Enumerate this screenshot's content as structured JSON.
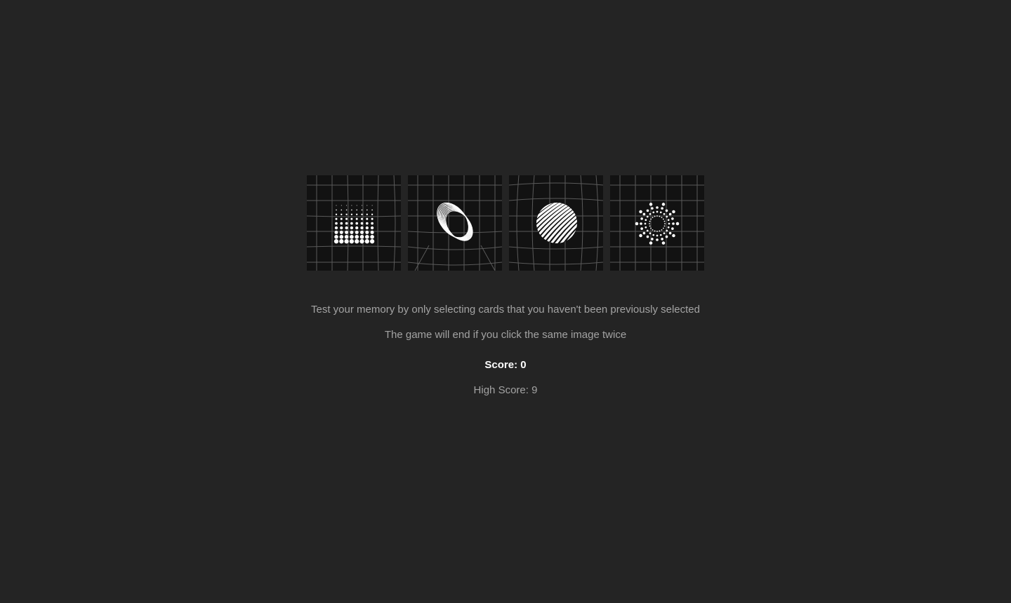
{
  "instructions": {
    "line1": "Test your memory by only selecting cards that you haven't been previously selected",
    "line2": "The game will end if you click the same image twice"
  },
  "score": {
    "label": "Score: 0",
    "value": 0
  },
  "high_score": {
    "label": "High Score: 9",
    "value": 9
  },
  "cards": [
    {
      "name": "dot-grid",
      "icon": "dot-grid-icon"
    },
    {
      "name": "wireframe-ring",
      "icon": "ring-icon"
    },
    {
      "name": "striped-sphere",
      "icon": "sphere-icon"
    },
    {
      "name": "radial-dots",
      "icon": "radial-burst-icon"
    }
  ],
  "colors": {
    "background": "#242424",
    "card_background": "#121212",
    "grid_lines": "#5a5a5a",
    "art": "#ffffff",
    "muted_text": "#a3a3a3"
  }
}
